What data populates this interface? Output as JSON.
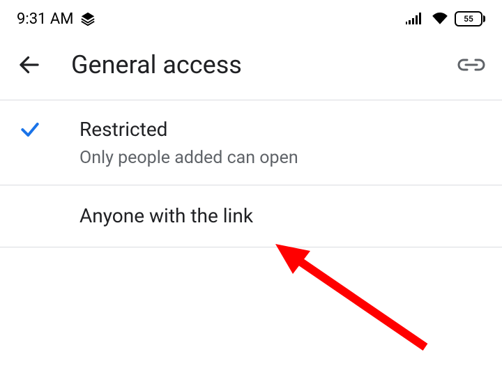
{
  "statusbar": {
    "time": "9:31 AM",
    "battery": "55"
  },
  "header": {
    "title": "General access"
  },
  "options": [
    {
      "title": "Restricted",
      "description": "Only people added can open",
      "selected": true
    },
    {
      "title": "Anyone with the link",
      "description": "",
      "selected": false
    }
  ],
  "annotation": {
    "arrow_color": "#ff0000"
  }
}
